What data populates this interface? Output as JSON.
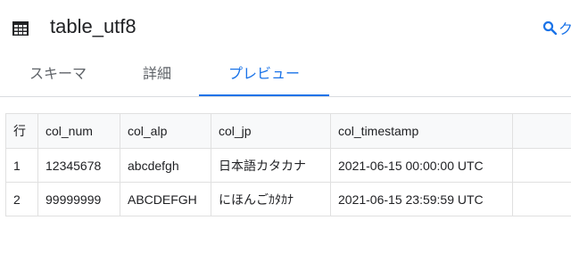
{
  "header": {
    "title": "table_utf8",
    "query_link": "ク"
  },
  "tabs": [
    {
      "label": "スキーマ",
      "active": false
    },
    {
      "label": "詳細",
      "active": false
    },
    {
      "label": "プレビュー",
      "active": true
    }
  ],
  "colors": {
    "accent": "#1a73e8",
    "text": "#202124",
    "muted": "#5f6368",
    "border": "#e0e0e0"
  },
  "table": {
    "columns": [
      "行",
      "col_num",
      "col_alp",
      "col_jp",
      "col_timestamp"
    ],
    "rows": [
      [
        "1",
        "12345678",
        "abcdefgh",
        "日本語カタカナ",
        "2021-06-15 00:00:00 UTC"
      ],
      [
        "2",
        "99999999",
        "ABCDEFGH",
        "にほんごｶﾀｶﾅ",
        "2021-06-15 23:59:59 UTC"
      ]
    ]
  }
}
